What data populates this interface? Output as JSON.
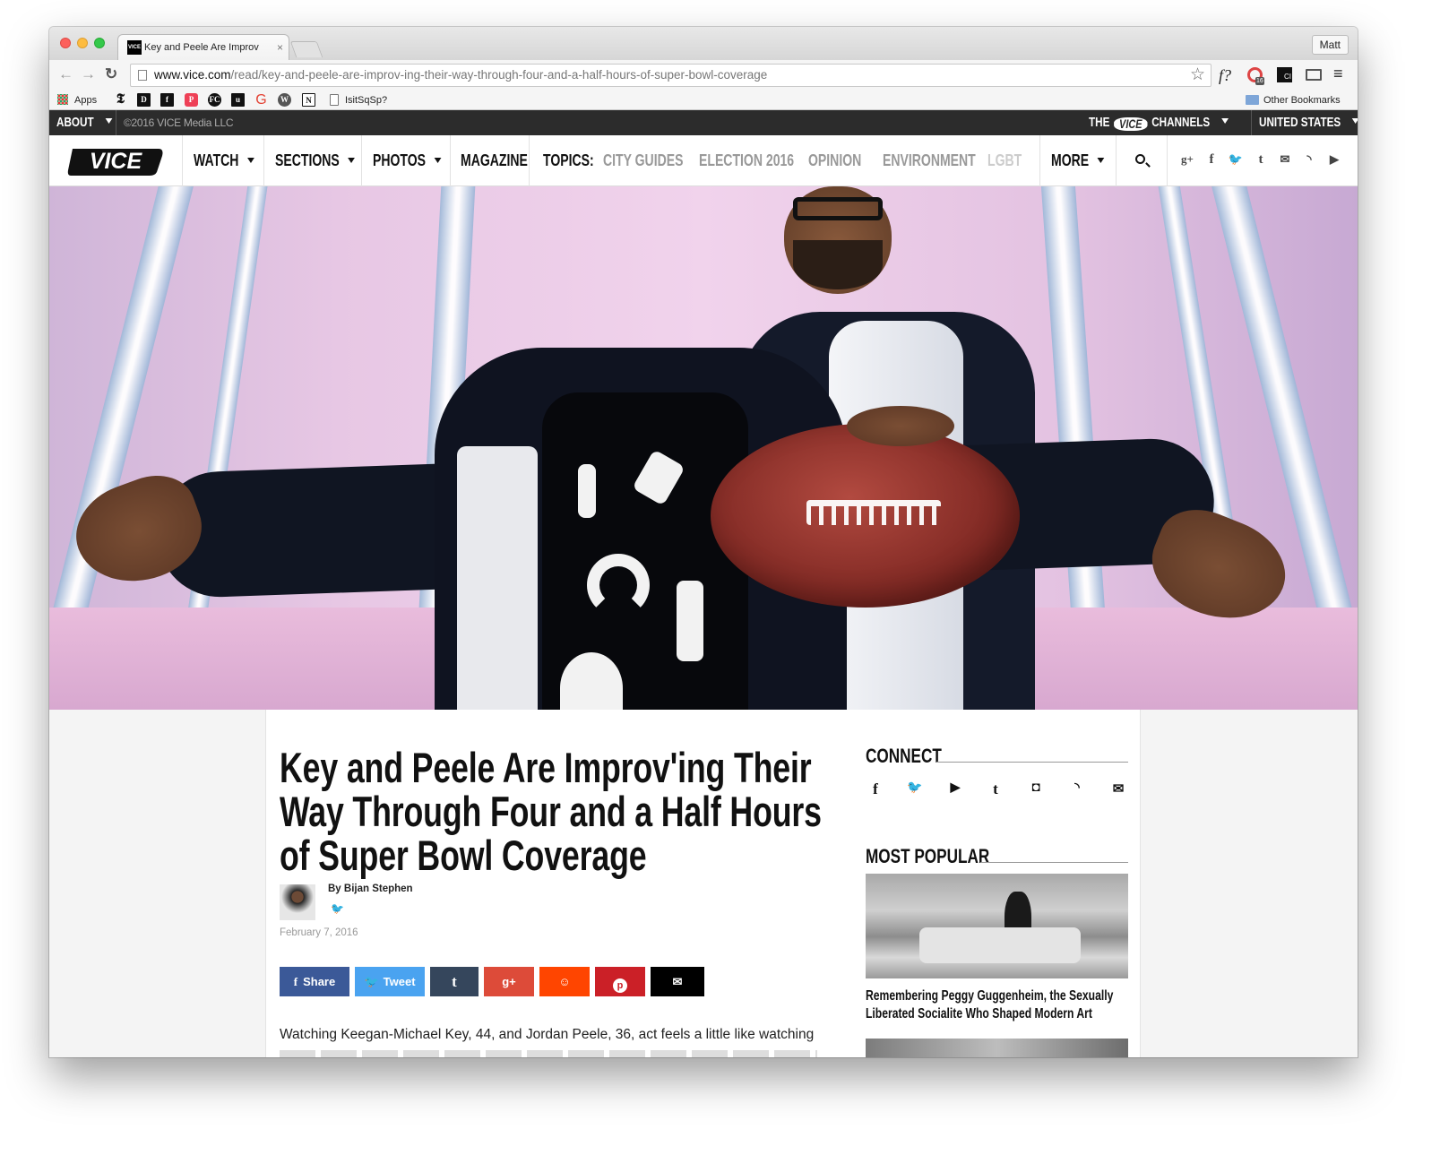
{
  "browser": {
    "tab_title": "Key and Peele Are Improv",
    "tab_favicon_text": "VICE",
    "tab_close": "×",
    "profile": "Matt",
    "url_domain": "www.vice.com",
    "url_path": "/read/key-and-peele-are-improv-ing-their-way-through-four-and-a-half-hours-of-super-bowl-coverage",
    "ext_f_label": "f?",
    "ext_badge": "16",
    "ext_ci_label": "CI",
    "bookmarks": {
      "apps": "Apps",
      "isitsqsp": "IsitSqSp?",
      "other": "Other Bookmarks"
    }
  },
  "vice_topbar": {
    "about": "ABOUT",
    "copyright": "©2016 VICE Media LLC",
    "the": "THE",
    "logo": "VICE",
    "channels": "CHANNELS",
    "country": "UNITED STATES"
  },
  "nav": {
    "logo": "VICE",
    "watch": "WATCH",
    "sections": "SECTIONS",
    "photos": "PHOTOS",
    "magazine": "MAGAZINE",
    "topics_label": "TOPICS:",
    "topics": [
      "CITY GUIDES",
      "ELECTION 2016",
      "OPINION",
      "ENVIRONMENT",
      "LGBT"
    ],
    "more": "MORE"
  },
  "article": {
    "title": "Key and Peele Are Improv'ing Their Way Through Four and a Half Hours of Super Bowl Coverage",
    "author": "By Bijan Stephen",
    "date": "February 7, 2016",
    "share_buttons": [
      {
        "label": "Share",
        "color": "#3b5998"
      },
      {
        "label": "Tweet",
        "color": "#4aa3f0"
      },
      {
        "label": "t",
        "color": "#35465c"
      },
      {
        "label": "g+",
        "color": "#dd4b39"
      },
      {
        "label": "reddit",
        "color": "#ff4500"
      },
      {
        "label": "pinterest",
        "color": "#cb2027"
      },
      {
        "label": "mail",
        "color": "#000000"
      }
    ],
    "body_first_line": "Watching Keegan-Michael Key, 44, and Jordan Peele, 36, act feels a little like watching"
  },
  "sidebar": {
    "connect_heading": "CONNECT",
    "most_popular_heading": "MOST POPULAR",
    "popular_item_1": "Remembering Peggy Guggenheim, the Sexually Liberated Socialite Who Shaped Modern Art"
  },
  "icons": {
    "nav_social": [
      "google-plus-icon",
      "facebook-icon",
      "twitter-icon",
      "tumblr-icon",
      "mail-icon",
      "rss-icon",
      "youtube-icon"
    ],
    "connect": [
      "facebook-icon",
      "twitter-icon",
      "youtube-icon",
      "tumblr-icon",
      "instagram-icon",
      "rss-icon",
      "mail-icon"
    ]
  }
}
